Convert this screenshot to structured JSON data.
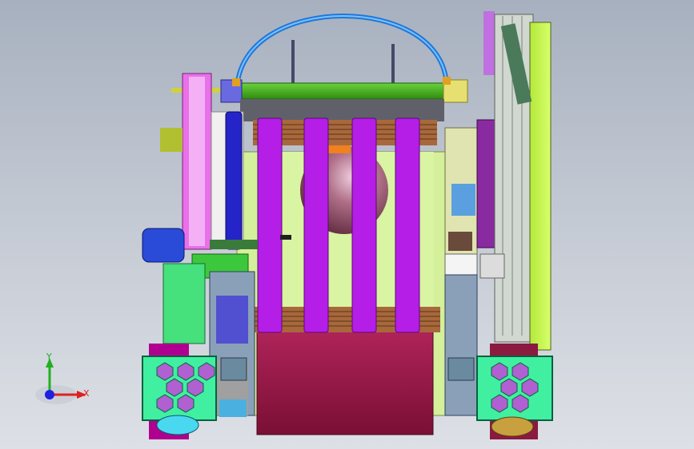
{
  "viewport": {
    "background_top": "#a7b0bf",
    "background_bottom": "#dde0e6"
  },
  "triad": {
    "x_label": "X",
    "y_label": "Y",
    "x_color": "#e02020",
    "y_color": "#20b020",
    "z_color": "#2020e0"
  },
  "model": {
    "description_icons": [
      "robot-assembly-icon"
    ],
    "colors": {
      "purple": "#b41ee6",
      "green_bar": "#3cb414",
      "lime": "#c8ff50",
      "maroon": "#9b1446",
      "cyan_blue": "#2882e6",
      "pale_yellow": "#e6f0a0"
    }
  }
}
